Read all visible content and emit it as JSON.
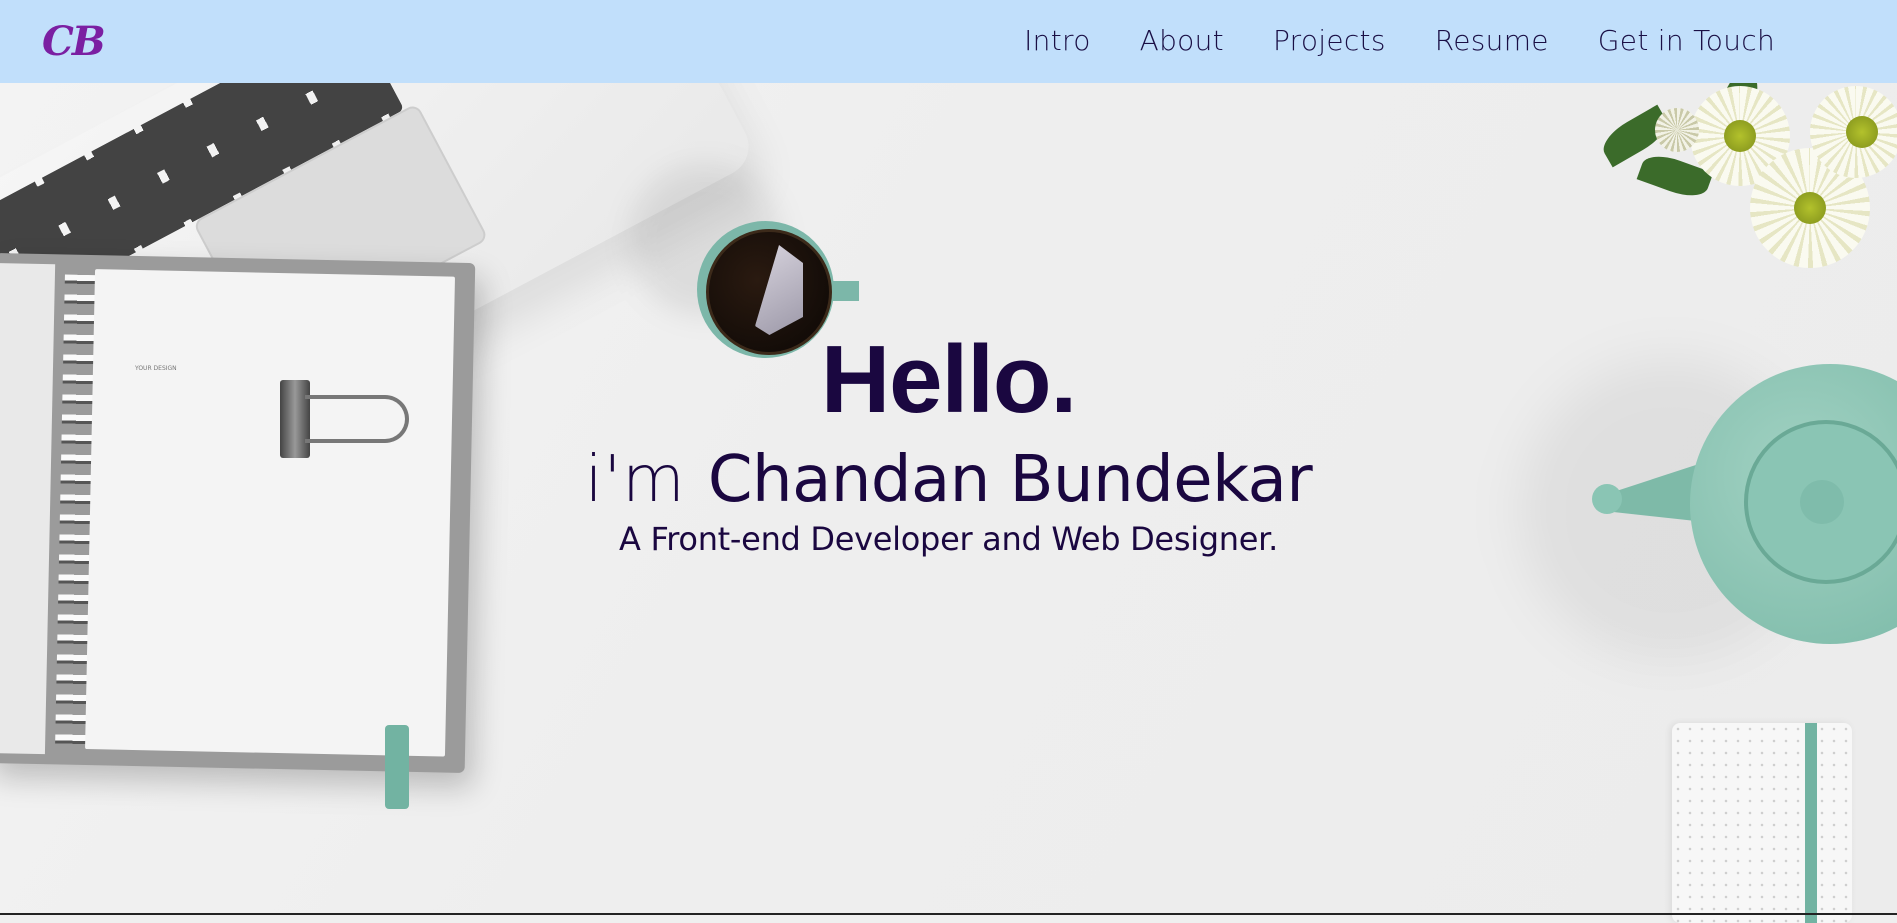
{
  "nav": {
    "logo": "CB",
    "links": [
      {
        "label": "Intro"
      },
      {
        "label": "About"
      },
      {
        "label": "Projects"
      },
      {
        "label": "Resume"
      },
      {
        "label": "Get in Touch"
      }
    ]
  },
  "hero": {
    "greeting": "Hello.",
    "im_prefix": "i'm",
    "name": "Chandan Bundekar",
    "tagline": "A Front-end Developer and Web Designer.",
    "notebook_label": "YOUR DESIGN"
  },
  "colors": {
    "nav_bg": "#c1dffb",
    "logo": "#7b1fa2",
    "text_dark": "#1a0740",
    "accent_mint": "#7cb7a9"
  },
  "icons": [
    "laptop-illustration",
    "notebook-illustration",
    "coffee-cup-illustration",
    "flowers-illustration",
    "teapot-illustration"
  ]
}
